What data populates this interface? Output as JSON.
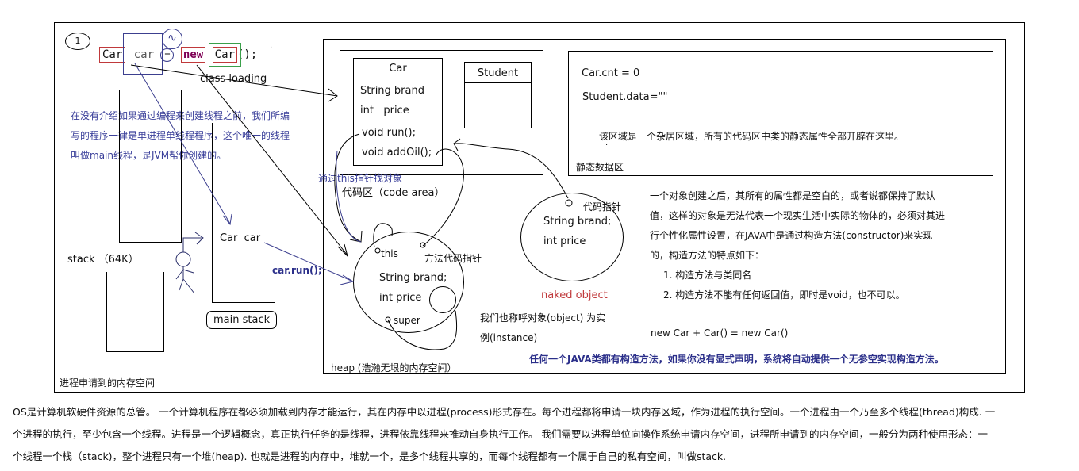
{
  "step_marker": "1",
  "code_line": {
    "type_name": "Car",
    "var_name": "car",
    "equals": "=",
    "keyword_new": "new",
    "ctor_name": "Car",
    "tail": "();"
  },
  "class_loading_label": "class loading",
  "thread_note": "在没有介绍如果通过编程来创建线程之前，我们所编写的程序一律是单进程单线程程序，这个唯一的线程叫做main线程，是JVM帮你创建的。",
  "thread_note_lines": [
    "在没有介绍如果通过编程来创建线程之前，我们所编",
    "写的程序一律是单进程单线程程序，这个唯一的线程",
    "叫做main线程，是JVM帮你创建的。"
  ],
  "stack": {
    "label": "stack （64K）",
    "main_stack_var": "Car  car",
    "main_stack_label": "main stack",
    "call_label": "car.run();"
  },
  "process_space_label": "进程申请到的内存空间",
  "code_area": {
    "label": "代码区（code area）",
    "this_lookup_note": "通过this指针找对象",
    "car_class": {
      "name": "Car",
      "fields": [
        "String brand",
        "int   price"
      ],
      "methods": [
        "void run();",
        "void addOil();"
      ]
    },
    "student_class": {
      "name": "Student"
    }
  },
  "static_area": {
    "lines": [
      "Car.cnt = 0",
      "Student.data=\"\""
    ],
    "note": "该区域是一个杂居区域，所有的代码区中类的静态属性全部开辟在这里。",
    "label": "静态数据区"
  },
  "heap": {
    "label": "heap (浩瀚无垠的内存空间）",
    "object": {
      "this_label": "this",
      "method_pointer_label": "方法代码指针",
      "fields": [
        "String brand;",
        "int price"
      ],
      "super_label": "super"
    },
    "naked_object": {
      "pointer_label": "代码指针",
      "fields": [
        "String brand;",
        "int price"
      ],
      "caption": "naked object"
    },
    "instance_note_lines": [
      "我们也称呼对象(object) 为实",
      "例(instance)"
    ]
  },
  "constructor_note": {
    "lines": [
      "一个对象创建之后，其所有的属性都是空白的，或者说都保持了默认",
      "值，这样的对象是无法代表一个现实生活中实际的物体的，必须对其进",
      "行个性化属性设置，在JAVA中是通过构造方法(constructor)来实现",
      "的，构造方法的特点如下："
    ],
    "points": [
      "1.  构造方法与类同名",
      "2.  构造方法不能有任何返回值，即时是void，也不可以。"
    ],
    "formula": "new Car + Car() = new Car()",
    "default_ctor_note": "任何一个JAVA类都有构造方法，如果你没有显式声明，系统将自动提供一个无参空实现构造方法。"
  },
  "footer_paragraph_lines": [
    "OS是计算机软硬件资源的总管。 一个计算机程序在都必须加载到内存才能运行，其在内存中以进程(process)形式存在。每个进程都将申请一块内存区域，作为进程的执行空间。一个进程由一个乃至多个线程(thread)构成. 一",
    "个进程的执行，至少包含一个线程。进程是一个逻辑概念，真正执行任务的是线程，进程依靠线程来推动自身执行工作。 我们需要以进程单位向操作系统申请内存空间，进程所申请到的内存空间，一般分为两种使用形态：一",
    "个线程一个栈（stack)，整个进程只有一个堆(heap). 也就是进程的内存中，堆就一个，是多个线程共享的，而每个线程都有一个属于自己的私有空间，叫做stack."
  ],
  "colors": {
    "note_blue": "#3a3f9a",
    "emphasis_navy": "#2b2f8a",
    "naked_red": "#c0393b",
    "keyword_purple": "#7f0055",
    "box_red": "#c0393b",
    "box_green": "#3aa04a",
    "box_purple": "#3c3f8f"
  }
}
